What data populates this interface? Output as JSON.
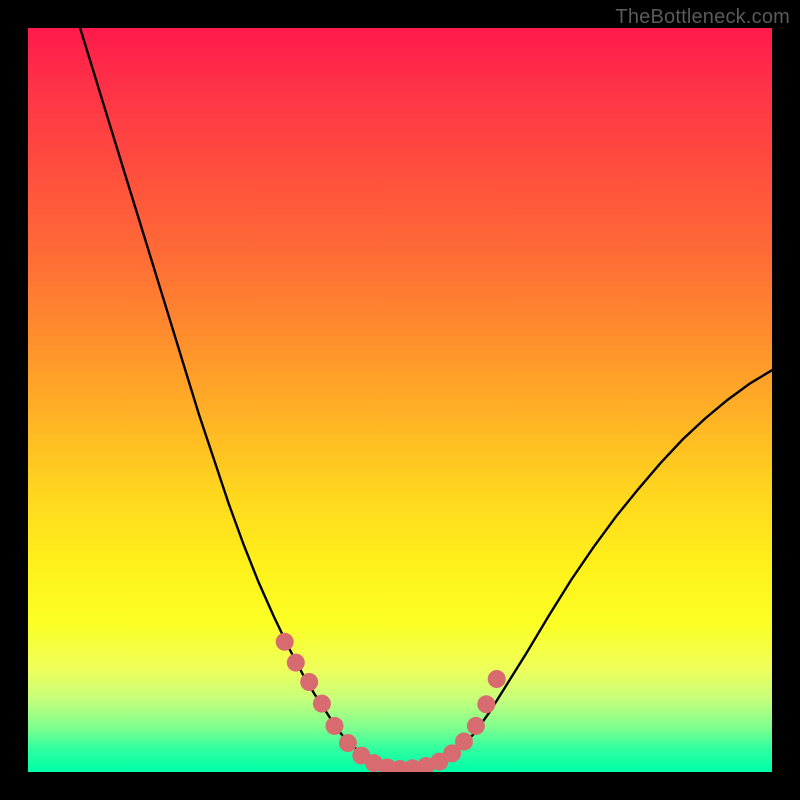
{
  "watermark": "TheBottleneck.com",
  "chart_data": {
    "type": "line",
    "title": "",
    "xlabel": "",
    "ylabel": "",
    "xlim": [
      0,
      100
    ],
    "ylim": [
      0,
      100
    ],
    "grid": false,
    "legend": false,
    "series": [
      {
        "name": "bottleneck-curve",
        "x_norm": [
          0.07,
          0.09,
          0.11,
          0.13,
          0.15,
          0.17,
          0.19,
          0.21,
          0.23,
          0.25,
          0.27,
          0.29,
          0.31,
          0.33,
          0.35,
          0.37,
          0.385,
          0.4,
          0.413,
          0.425,
          0.44,
          0.455,
          0.47,
          0.49,
          0.51,
          0.53,
          0.55,
          0.565,
          0.58,
          0.6,
          0.62,
          0.64,
          0.67,
          0.7,
          0.73,
          0.76,
          0.79,
          0.82,
          0.85,
          0.88,
          0.91,
          0.94,
          0.97,
          1.0
        ],
        "y_norm": [
          1.0,
          0.935,
          0.87,
          0.805,
          0.74,
          0.675,
          0.61,
          0.545,
          0.48,
          0.42,
          0.36,
          0.305,
          0.255,
          0.21,
          0.168,
          0.13,
          0.105,
          0.082,
          0.062,
          0.046,
          0.032,
          0.021,
          0.013,
          0.007,
          0.004,
          0.006,
          0.012,
          0.02,
          0.032,
          0.052,
          0.08,
          0.112,
          0.16,
          0.21,
          0.258,
          0.302,
          0.343,
          0.38,
          0.415,
          0.447,
          0.475,
          0.5,
          0.522,
          0.54
        ],
        "markers": {
          "x_norm": [
            0.345,
            0.36,
            0.378,
            0.395,
            0.412,
            0.43,
            0.448,
            0.465,
            0.483,
            0.5,
            0.517,
            0.535,
            0.553,
            0.57,
            0.586,
            0.602,
            0.616,
            0.63
          ],
          "y_norm": [
            0.175,
            0.147,
            0.121,
            0.092,
            0.062,
            0.039,
            0.022,
            0.012,
            0.006,
            0.004,
            0.005,
            0.008,
            0.014,
            0.025,
            0.041,
            0.062,
            0.091,
            0.125
          ]
        }
      }
    ],
    "background_gradient": {
      "direction": "top-to-bottom",
      "stops": [
        {
          "pos": 0.0,
          "color": "#ff1a4b"
        },
        {
          "pos": 0.5,
          "color": "#ffc020"
        },
        {
          "pos": 0.8,
          "color": "#f8ff30"
        },
        {
          "pos": 1.0,
          "color": "#00ffa8"
        }
      ]
    }
  }
}
